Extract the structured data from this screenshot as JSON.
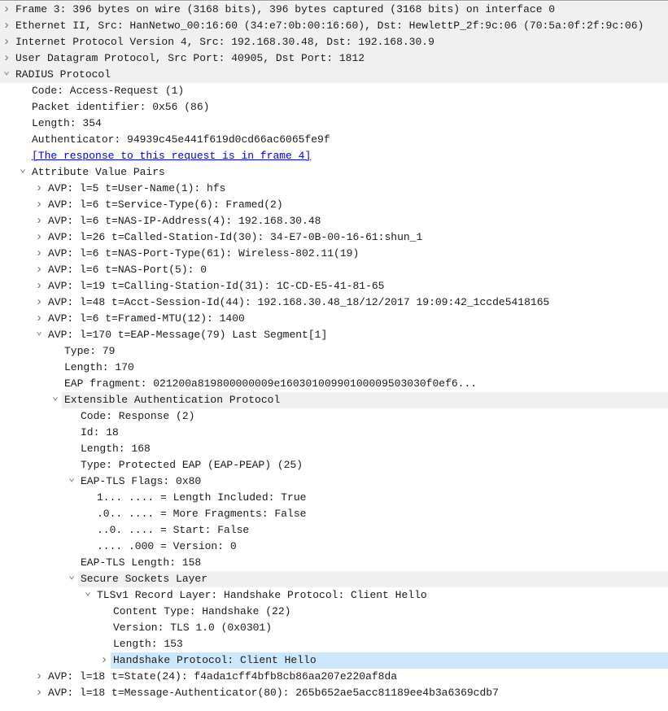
{
  "colors": {
    "protocol_bg": "#f0f0f0",
    "selected_bg": "#cce8ff",
    "link": "#0000ee"
  },
  "rows": [
    {
      "level": 0,
      "state": "collapsed",
      "kind": "proto",
      "text": "Frame 3: 396 bytes on wire (3168 bits), 396 bytes captured (3168 bits) on interface 0"
    },
    {
      "level": 0,
      "state": "collapsed",
      "kind": "proto",
      "text": "Ethernet II, Src: HanNetwo_00:16:60 (34:e7:0b:00:16:60), Dst: HewlettP_2f:9c:06 (70:5a:0f:2f:9c:06)"
    },
    {
      "level": 0,
      "state": "collapsed",
      "kind": "proto",
      "text": "Internet Protocol Version 4, Src: 192.168.30.48, Dst: 192.168.30.9"
    },
    {
      "level": 0,
      "state": "collapsed",
      "kind": "proto",
      "text": "User Datagram Protocol, Src Port: 40905, Dst Port: 1812"
    },
    {
      "level": 0,
      "state": "expanded",
      "kind": "proto",
      "text": "RADIUS Protocol"
    },
    {
      "level": 1,
      "state": "none",
      "kind": "field",
      "text": "Code: Access-Request (1)"
    },
    {
      "level": 1,
      "state": "none",
      "kind": "field",
      "text": "Packet identifier: 0x56 (86)"
    },
    {
      "level": 1,
      "state": "none",
      "kind": "field",
      "text": "Length: 354"
    },
    {
      "level": 1,
      "state": "none",
      "kind": "field",
      "text": "Authenticator: 94939c45e441f619d0cd66ac6065fe9f"
    },
    {
      "level": 1,
      "state": "none",
      "kind": "link",
      "text": "[The response to this request is in frame 4]"
    },
    {
      "level": 1,
      "state": "expanded",
      "kind": "field",
      "text": "Attribute Value Pairs"
    },
    {
      "level": 2,
      "state": "collapsed",
      "kind": "field",
      "text": "AVP: l=5 t=User-Name(1): hfs"
    },
    {
      "level": 2,
      "state": "collapsed",
      "kind": "field",
      "text": "AVP: l=6 t=Service-Type(6): Framed(2)"
    },
    {
      "level": 2,
      "state": "collapsed",
      "kind": "field",
      "text": "AVP: l=6 t=NAS-IP-Address(4): 192.168.30.48"
    },
    {
      "level": 2,
      "state": "collapsed",
      "kind": "field",
      "text": "AVP: l=26 t=Called-Station-Id(30): 34-E7-0B-00-16-61:shun_1"
    },
    {
      "level": 2,
      "state": "collapsed",
      "kind": "field",
      "text": "AVP: l=6 t=NAS-Port-Type(61): Wireless-802.11(19)"
    },
    {
      "level": 2,
      "state": "collapsed",
      "kind": "field",
      "text": "AVP: l=6 t=NAS-Port(5): 0"
    },
    {
      "level": 2,
      "state": "collapsed",
      "kind": "field",
      "text": "AVP: l=19 t=Calling-Station-Id(31): 1C-CD-E5-41-81-65"
    },
    {
      "level": 2,
      "state": "collapsed",
      "kind": "field",
      "text": "AVP: l=48 t=Acct-Session-Id(44): 192.168.30.48_18/12/2017 19:09:42_1ccde5418165"
    },
    {
      "level": 2,
      "state": "collapsed",
      "kind": "field",
      "text": "AVP: l=6 t=Framed-MTU(12): 1400"
    },
    {
      "level": 2,
      "state": "expanded",
      "kind": "field",
      "text": "AVP: l=170 t=EAP-Message(79) Last Segment[1]"
    },
    {
      "level": 3,
      "state": "none",
      "kind": "field",
      "text": "Type: 79"
    },
    {
      "level": 3,
      "state": "none",
      "kind": "field",
      "text": "Length: 170"
    },
    {
      "level": 3,
      "state": "none",
      "kind": "field",
      "text": "EAP fragment: 021200a819800000009e16030100990100009503030f0ef6..."
    },
    {
      "level": 3,
      "state": "expanded",
      "kind": "proto",
      "text": "Extensible Authentication Protocol"
    },
    {
      "level": 4,
      "state": "none",
      "kind": "field",
      "text": "Code: Response (2)"
    },
    {
      "level": 4,
      "state": "none",
      "kind": "field",
      "text": "Id: 18"
    },
    {
      "level": 4,
      "state": "none",
      "kind": "field",
      "text": "Length: 168"
    },
    {
      "level": 4,
      "state": "none",
      "kind": "field",
      "text": "Type: Protected EAP (EAP-PEAP) (25)"
    },
    {
      "level": 4,
      "state": "expanded",
      "kind": "field",
      "text": "EAP-TLS Flags: 0x80"
    },
    {
      "level": 5,
      "state": "none",
      "kind": "field",
      "text": "1... .... = Length Included: True"
    },
    {
      "level": 5,
      "state": "none",
      "kind": "field",
      "text": ".0.. .... = More Fragments: False"
    },
    {
      "level": 5,
      "state": "none",
      "kind": "field",
      "text": "..0. .... = Start: False"
    },
    {
      "level": 5,
      "state": "none",
      "kind": "field",
      "text": ".... .000 = Version: 0"
    },
    {
      "level": 4,
      "state": "none",
      "kind": "field",
      "text": "EAP-TLS Length: 158"
    },
    {
      "level": 4,
      "state": "expanded",
      "kind": "proto",
      "text": "Secure Sockets Layer"
    },
    {
      "level": 5,
      "state": "expanded",
      "kind": "field",
      "text": "TLSv1 Record Layer: Handshake Protocol: Client Hello"
    },
    {
      "level": 6,
      "state": "none",
      "kind": "field",
      "text": "Content Type: Handshake (22)"
    },
    {
      "level": 6,
      "state": "none",
      "kind": "field",
      "text": "Version: TLS 1.0 (0x0301)"
    },
    {
      "level": 6,
      "state": "none",
      "kind": "field",
      "text": "Length: 153"
    },
    {
      "level": 6,
      "state": "collapsed",
      "kind": "selected",
      "text": "Handshake Protocol: Client Hello"
    },
    {
      "level": 2,
      "state": "collapsed",
      "kind": "field",
      "text": "AVP: l=18 t=State(24): f4ada1cff4bfb8cb86aa207e220af8da"
    },
    {
      "level": 2,
      "state": "collapsed",
      "kind": "field",
      "text": "AVP: l=18 t=Message-Authenticator(80): 265b652ae5acc81189ee4b3a6369cdb7"
    }
  ]
}
